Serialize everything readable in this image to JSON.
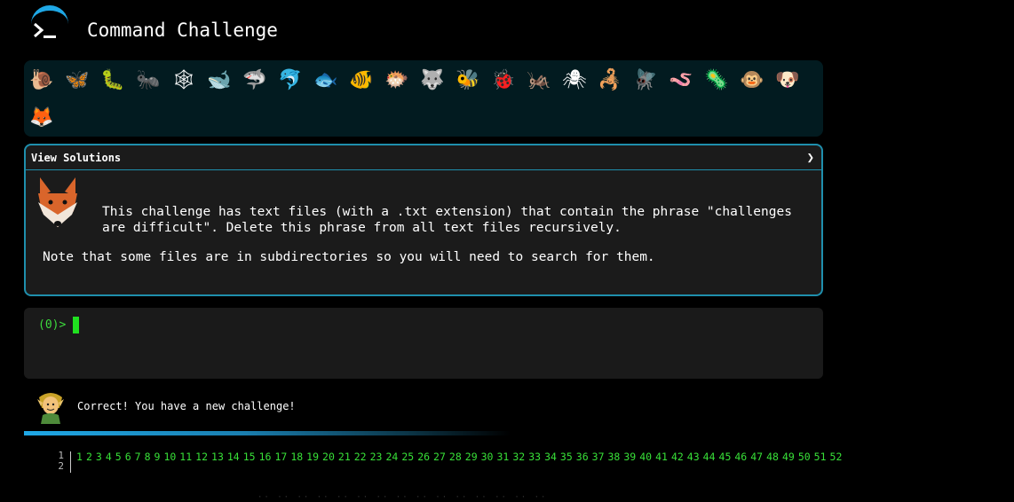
{
  "header": {
    "title": "Command Challenge",
    "logo_icon": "terminal-icon"
  },
  "animals": [
    {
      "name": "snail",
      "glyph": "🐌"
    },
    {
      "name": "butterfly",
      "glyph": "🦋"
    },
    {
      "name": "caterpillar",
      "glyph": "🐛"
    },
    {
      "name": "ant",
      "glyph": "🐜"
    },
    {
      "name": "spider-web",
      "glyph": "🕸"
    },
    {
      "name": "whale",
      "glyph": "🐋"
    },
    {
      "name": "shark",
      "glyph": "🦈"
    },
    {
      "name": "dolphin",
      "glyph": "🐬"
    },
    {
      "name": "fish",
      "glyph": "🐟"
    },
    {
      "name": "tropical-fish",
      "glyph": "🐠"
    },
    {
      "name": "blowfish",
      "glyph": "🐡"
    },
    {
      "name": "wolf",
      "glyph": "🐺"
    },
    {
      "name": "bee",
      "glyph": "🐝"
    },
    {
      "name": "ladybug",
      "glyph": "🐞"
    },
    {
      "name": "cricket",
      "glyph": "🦗"
    },
    {
      "name": "spider",
      "glyph": "🕷"
    },
    {
      "name": "scorpion",
      "glyph": "🦂"
    },
    {
      "name": "fly",
      "glyph": "🪰"
    },
    {
      "name": "worm",
      "glyph": "🪱"
    },
    {
      "name": "microbe",
      "glyph": "🦠"
    },
    {
      "name": "monkey",
      "glyph": "🐵"
    },
    {
      "name": "dog",
      "glyph": "🐶"
    },
    {
      "name": "fox",
      "glyph": "🦊"
    }
  ],
  "challenge": {
    "view_solutions": "View Solutions",
    "expand_icon": "chevron-right-icon",
    "avatar_icon": "fox-icon",
    "description_1": "This challenge has text files (with a .txt extension) that contain the phrase \"challenges are difficult\". Delete this phrase from all text files recursively.",
    "description_2": "Note that some files are in subdirectories so you will need to search for them."
  },
  "terminal": {
    "prompt": "(0)>"
  },
  "feedback": {
    "avatar_icon": "elf-icon",
    "message": "Correct! You have a new challenge!"
  },
  "progress": {
    "fraction": 0.48
  },
  "levels": {
    "line_numbers": [
      "1",
      "2"
    ],
    "items": [
      "1",
      "2",
      "3",
      "4",
      "5",
      "6",
      "7",
      "8",
      "9",
      "10",
      "11",
      "12",
      "13",
      "14",
      "15",
      "16",
      "17",
      "18",
      "19",
      "20",
      "21",
      "22",
      "23",
      "24",
      "25",
      "26",
      "27",
      "28",
      "29",
      "30",
      "31",
      "32",
      "33",
      "34",
      "35",
      "36",
      "37",
      "38",
      "39",
      "40",
      "41",
      "42",
      "43",
      "44",
      "45",
      "46",
      "47",
      "48",
      "49",
      "50",
      "51",
      "52"
    ]
  },
  "colors": {
    "accent": "#1fa8e6",
    "prompt_green": "#3ddb3d",
    "panel_border": "#1f8fad"
  }
}
